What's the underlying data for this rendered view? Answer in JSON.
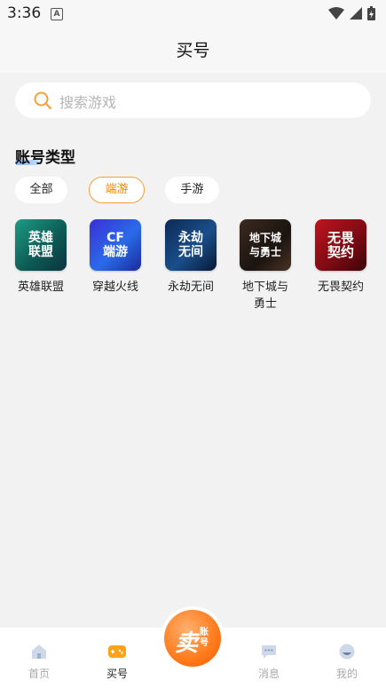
{
  "status": {
    "time": "3:36",
    "notif": "A"
  },
  "header": {
    "title": "买号"
  },
  "search": {
    "placeholder": "搜索游戏"
  },
  "section": {
    "title": "账号类型"
  },
  "chips": [
    "全部",
    "端游",
    "手游"
  ],
  "games": [
    {
      "name": "英雄联盟",
      "logo": "英雄 联盟"
    },
    {
      "name": "穿越火线",
      "logo": "CF 端游"
    },
    {
      "name": "永劫无间",
      "logo": "永劫 无间"
    },
    {
      "name": "地下城与勇士",
      "logo": "地下城 与勇士"
    },
    {
      "name": "无畏契约",
      "logo": "无畏 契约"
    }
  ],
  "tabs": [
    {
      "label": "首页"
    },
    {
      "label": "买号"
    },
    {
      "label": "消息"
    },
    {
      "label": "我的"
    }
  ],
  "center_button": {
    "big": "卖",
    "small": "账号"
  },
  "colors": {
    "accent": "#f08a00",
    "orange": "#ff7a1a"
  }
}
